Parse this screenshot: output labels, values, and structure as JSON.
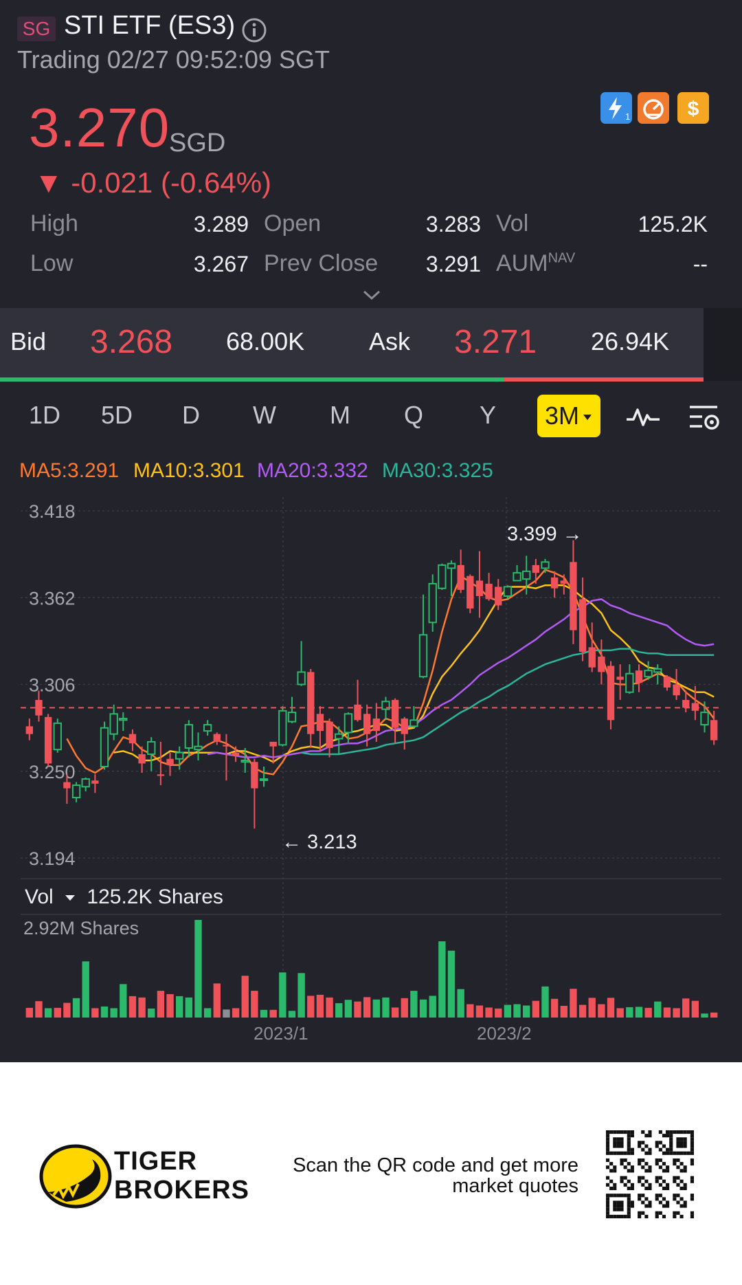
{
  "header": {
    "market_badge": "SG",
    "title": "STI ETF (ES3)",
    "subtitle": "Trading 02/27 09:52:09 SGT"
  },
  "quote": {
    "price": "3.270",
    "currency": "SGD",
    "change": "▼ -0.021 (-0.64%)",
    "down_color": "#f0525a",
    "up_color": "#2bba6b"
  },
  "badges": [
    {
      "icon": "lightning-level-1-icon",
      "color": "#3a8fe8"
    },
    {
      "icon": "speedometer-icon",
      "color": "#f07b2f"
    },
    {
      "icon": "dollar-icon",
      "color": "#f5a623"
    }
  ],
  "stats": {
    "high_label": "High",
    "high": "3.289",
    "open_label": "Open",
    "open": "3.283",
    "vol_label": "Vol",
    "vol": "125.2K",
    "low_label": "Low",
    "low": "3.267",
    "prev_close_label": "Prev Close",
    "prev_close": "3.291",
    "aum_label": "AUM",
    "aum_sup": "NAV",
    "aum": "--"
  },
  "bidask": {
    "bid_label": "Bid",
    "bid": "3.268",
    "bid_size": "68.00K",
    "ask_label": "Ask",
    "ask": "3.271",
    "ask_size": "26.94K",
    "bid_share": 0.716
  },
  "tabs": [
    "1D",
    "5D",
    "D",
    "W",
    "M",
    "Q",
    "Y"
  ],
  "active_tab": "3M",
  "ma_legend": [
    {
      "label": "MA5:3.291",
      "color": "#ff7a2f"
    },
    {
      "label": "MA10:3.301",
      "color": "#ffc21a"
    },
    {
      "label": "MA20:3.332",
      "color": "#b35cf5"
    },
    {
      "label": "MA30:3.325",
      "color": "#2bb59a"
    }
  ],
  "chart_data": {
    "type": "candlestick",
    "y_ticks": [
      "3.418",
      "3.362",
      "3.306",
      "3.250",
      "3.194"
    ],
    "ylim": [
      3.194,
      3.418
    ],
    "reference_line": 3.291,
    "high_annotation": "3.399 →",
    "low_annotation": "← 3.213",
    "x_labels": [
      "2023/1",
      "2023/2"
    ],
    "candles": [
      [
        3.279,
        3.274,
        3.284,
        3.27
      ],
      [
        3.296,
        3.286,
        3.302,
        3.282
      ],
      [
        3.285,
        3.255,
        3.287,
        3.253
      ],
      [
        3.264,
        3.281,
        3.284,
        3.262
      ],
      [
        3.243,
        3.239,
        3.248,
        3.229
      ],
      [
        3.233,
        3.241,
        3.243,
        3.23
      ],
      [
        3.24,
        3.245,
        3.246,
        3.237
      ],
      [
        3.244,
        3.242,
        3.248,
        3.236
      ],
      [
        3.253,
        3.278,
        3.282,
        3.251
      ],
      [
        3.274,
        3.287,
        3.293,
        3.27
      ],
      [
        3.283,
        3.284,
        3.288,
        3.276
      ],
      [
        3.274,
        3.268,
        3.277,
        3.263
      ],
      [
        3.261,
        3.255,
        3.266,
        3.249
      ],
      [
        3.261,
        3.269,
        3.272,
        3.25
      ],
      [
        3.248,
        3.247,
        3.269,
        3.241
      ],
      [
        3.258,
        3.254,
        3.262,
        3.247
      ],
      [
        3.258,
        3.262,
        3.266,
        3.251
      ],
      [
        3.265,
        3.28,
        3.283,
        3.259
      ],
      [
        3.264,
        3.266,
        3.275,
        3.257
      ],
      [
        3.276,
        3.28,
        3.283,
        3.273
      ],
      [
        3.274,
        3.269,
        3.275,
        3.267
      ],
      [
        3.267,
        3.266,
        3.274,
        3.244
      ],
      [
        3.262,
        3.26,
        3.266,
        3.256
      ],
      [
        3.256,
        3.257,
        3.265,
        3.249
      ],
      [
        3.256,
        3.239,
        3.258,
        3.213
      ],
      [
        3.245,
        3.245,
        3.253,
        3.24
      ],
      [
        3.269,
        3.266,
        3.268,
        3.255
      ],
      [
        3.267,
        3.289,
        3.292,
        3.266
      ],
      [
        3.282,
        3.288,
        3.298,
        3.281
      ],
      [
        3.306,
        3.314,
        3.334,
        3.305
      ],
      [
        3.314,
        3.274,
        3.316,
        3.265
      ],
      [
        3.287,
        3.276,
        3.292,
        3.263
      ],
      [
        3.282,
        3.265,
        3.284,
        3.259
      ],
      [
        3.271,
        3.274,
        3.279,
        3.261
      ],
      [
        3.275,
        3.287,
        3.288,
        3.268
      ],
      [
        3.293,
        3.283,
        3.309,
        3.282
      ],
      [
        3.287,
        3.274,
        3.293,
        3.266
      ],
      [
        3.284,
        3.276,
        3.294,
        3.269
      ],
      [
        3.29,
        3.295,
        3.298,
        3.283
      ],
      [
        3.296,
        3.278,
        3.297,
        3.268
      ],
      [
        3.284,
        3.274,
        3.285,
        3.264
      ],
      [
        3.279,
        3.283,
        3.292,
        3.278
      ],
      [
        3.311,
        3.338,
        3.364,
        3.31
      ],
      [
        3.346,
        3.371,
        3.377,
        3.34
      ],
      [
        3.368,
        3.383,
        3.384,
        3.367
      ],
      [
        3.381,
        3.384,
        3.386,
        3.363
      ],
      [
        3.383,
        3.367,
        3.393,
        3.365
      ],
      [
        3.376,
        3.355,
        3.377,
        3.352
      ],
      [
        3.373,
        3.363,
        3.392,
        3.349
      ],
      [
        3.371,
        3.361,
        3.378,
        3.36
      ],
      [
        3.369,
        3.357,
        3.374,
        3.354
      ],
      [
        3.363,
        3.369,
        3.37,
        3.361
      ],
      [
        3.373,
        3.378,
        3.383,
        3.373
      ],
      [
        3.374,
        3.379,
        3.389,
        3.364
      ],
      [
        3.383,
        3.378,
        3.387,
        3.371
      ],
      [
        3.381,
        3.385,
        3.387,
        3.378
      ],
      [
        3.375,
        3.368,
        3.379,
        3.362
      ],
      [
        3.373,
        3.371,
        3.377,
        3.364
      ],
      [
        3.385,
        3.341,
        3.399,
        3.332
      ],
      [
        3.361,
        3.327,
        3.375,
        3.321
      ],
      [
        3.33,
        3.317,
        3.346,
        3.314
      ],
      [
        3.324,
        3.314,
        3.335,
        3.306
      ],
      [
        3.318,
        3.283,
        3.321,
        3.277
      ],
      [
        3.311,
        3.309,
        3.319,
        3.296
      ],
      [
        3.301,
        3.313,
        3.319,
        3.3
      ],
      [
        3.315,
        3.307,
        3.319,
        3.301
      ],
      [
        3.311,
        3.315,
        3.321,
        3.309
      ],
      [
        3.314,
        3.316,
        3.319,
        3.306
      ],
      [
        3.311,
        3.304,
        3.312,
        3.302
      ],
      [
        3.306,
        3.299,
        3.316,
        3.296
      ],
      [
        3.296,
        3.291,
        3.302,
        3.288
      ],
      [
        3.294,
        3.289,
        3.305,
        3.283
      ],
      [
        3.28,
        3.288,
        3.295,
        3.275
      ],
      [
        3.283,
        3.27,
        3.289,
        3.267
      ]
    ],
    "ma5": [
      null,
      null,
      null,
      null,
      3.271,
      3.26,
      3.252,
      3.249,
      3.253,
      3.263,
      3.272,
      3.27,
      3.264,
      3.261,
      3.256,
      3.254,
      3.254,
      3.26,
      3.263,
      3.267,
      3.27,
      3.268,
      3.264,
      3.261,
      3.252,
      3.249,
      3.248,
      3.256,
      3.266,
      3.279,
      3.28,
      3.282,
      3.282,
      3.277,
      3.271,
      3.272,
      3.275,
      3.278,
      3.284,
      3.282,
      3.278,
      3.278,
      3.294,
      3.315,
      3.34,
      3.361,
      3.376,
      3.372,
      3.368,
      3.362,
      3.36,
      3.361,
      3.365,
      3.369,
      3.373,
      3.38,
      3.378,
      3.375,
      3.366,
      3.35,
      3.335,
      3.325,
      3.307,
      3.306,
      3.306,
      3.307,
      3.31,
      3.313,
      3.311,
      3.308,
      3.301,
      3.296,
      3.292,
      3.284
    ],
    "ma10": [
      null,
      null,
      null,
      null,
      null,
      null,
      null,
      null,
      null,
      3.262,
      3.263,
      3.261,
      3.257,
      3.257,
      3.259,
      3.263,
      3.262,
      3.262,
      3.262,
      3.262,
      3.262,
      3.261,
      3.263,
      3.263,
      3.261,
      3.259,
      3.256,
      3.26,
      3.263,
      3.265,
      3.266,
      3.265,
      3.269,
      3.271,
      3.275,
      3.276,
      3.278,
      3.28,
      3.28,
      3.276,
      3.277,
      3.278,
      3.286,
      3.3,
      3.311,
      3.318,
      3.326,
      3.333,
      3.341,
      3.351,
      3.361,
      3.369,
      3.369,
      3.369,
      3.368,
      3.37,
      3.37,
      3.37,
      3.367,
      3.362,
      3.358,
      3.352,
      3.341,
      3.336,
      3.33,
      3.321,
      3.317,
      3.316,
      3.309,
      3.307,
      3.304,
      3.301,
      3.301,
      3.298
    ],
    "ma20": [
      null,
      null,
      null,
      null,
      null,
      null,
      null,
      null,
      null,
      null,
      null,
      null,
      null,
      null,
      null,
      null,
      null,
      null,
      null,
      3.261,
      3.262,
      3.261,
      3.26,
      3.259,
      3.259,
      3.26,
      3.259,
      3.26,
      3.261,
      3.262,
      3.263,
      3.263,
      3.266,
      3.267,
      3.268,
      3.268,
      3.27,
      3.273,
      3.276,
      3.277,
      3.278,
      3.28,
      3.284,
      3.289,
      3.293,
      3.296,
      3.301,
      3.306,
      3.312,
      3.316,
      3.32,
      3.323,
      3.327,
      3.331,
      3.335,
      3.34,
      3.344,
      3.348,
      3.353,
      3.356,
      3.36,
      3.361,
      3.357,
      3.355,
      3.352,
      3.35,
      3.348,
      3.346,
      3.344,
      3.339,
      3.335,
      3.332,
      3.331,
      3.332
    ],
    "ma30": [
      null,
      null,
      null,
      null,
      null,
      null,
      null,
      null,
      null,
      null,
      null,
      null,
      null,
      null,
      null,
      null,
      null,
      null,
      null,
      null,
      null,
      null,
      null,
      null,
      null,
      null,
      null,
      null,
      null,
      3.262,
      3.261,
      3.261,
      3.261,
      3.261,
      3.262,
      3.263,
      3.264,
      3.265,
      3.267,
      3.268,
      3.269,
      3.27,
      3.272,
      3.276,
      3.28,
      3.284,
      3.288,
      3.291,
      3.295,
      3.298,
      3.302,
      3.305,
      3.309,
      3.313,
      3.316,
      3.319,
      3.321,
      3.323,
      3.325,
      3.326,
      3.328,
      3.328,
      3.328,
      3.329,
      3.329,
      3.327,
      3.326,
      3.326,
      3.325,
      3.325,
      3.325,
      3.325,
      3.325,
      3.325
    ],
    "volume_label": "Vol",
    "volume_current": "125.2K Shares",
    "volume_max_label": "2.92M Shares",
    "volume_max": 2920000,
    "volumes": [
      290,
      490,
      280,
      290,
      440,
      580,
      1680,
      280,
      330,
      280,
      1000,
      640,
      600,
      270,
      800,
      700,
      640,
      600,
      2920,
      280,
      1020,
      240,
      280,
      1250,
      800,
      230,
      230,
      1350,
      200,
      1330,
      650,
      680,
      600,
      430,
      530,
      480,
      610,
      540,
      600,
      300,
      580,
      800,
      540,
      650,
      2280,
      2000,
      850,
      400,
      360,
      300,
      270,
      380,
      400,
      360,
      500,
      930,
      560,
      350,
      860,
      380,
      590,
      400,
      590,
      280,
      310,
      320,
      290,
      480,
      300,
      280,
      570,
      500,
      120,
      150
    ],
    "volume_colors": [
      "r",
      "r",
      "g",
      "r",
      "r",
      "g",
      "g",
      "r",
      "g",
      "g",
      "g",
      "r",
      "r",
      "g",
      "r",
      "r",
      "g",
      "g",
      "g",
      "g",
      "r",
      "gray",
      "r",
      "r",
      "r",
      "g",
      "r",
      "g",
      "g",
      "g",
      "r",
      "r",
      "r",
      "g",
      "g",
      "r",
      "r",
      "g",
      "g",
      "r",
      "r",
      "g",
      "g",
      "g",
      "g",
      "g",
      "g",
      "r",
      "r",
      "r",
      "r",
      "g",
      "g",
      "g",
      "r",
      "g",
      "r",
      "r",
      "r",
      "r",
      "r",
      "r",
      "r",
      "r",
      "g",
      "g",
      "r",
      "g",
      "r",
      "r",
      "r",
      "r",
      "g",
      "r"
    ]
  },
  "footer": {
    "brand_line1": "TIGER",
    "brand_line2": "BROKERS",
    "promo_line1": "Scan the QR code and get more",
    "promo_line2": "market quotes"
  }
}
